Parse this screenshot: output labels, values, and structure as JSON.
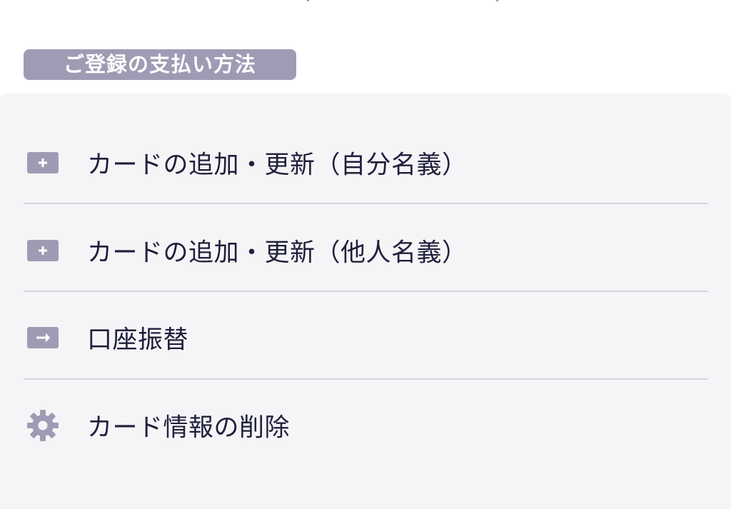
{
  "section": {
    "title": "ご登録の支払い方法"
  },
  "menu": {
    "items": [
      {
        "label": "カードの追加・更新（自分名義）",
        "icon": "plus-icon"
      },
      {
        "label": "カードの追加・更新（他人名義）",
        "icon": "plus-icon"
      },
      {
        "label": "口座振替",
        "icon": "arrow-right-icon"
      },
      {
        "label": "カード情報の削除",
        "icon": "gear-icon"
      }
    ]
  },
  "colors": {
    "badge": "#9e9cb4",
    "panel": "#f5f5f7",
    "divider": "#d4d2e0",
    "text": "#1f1f3c",
    "icon": "#9e9cb4"
  }
}
